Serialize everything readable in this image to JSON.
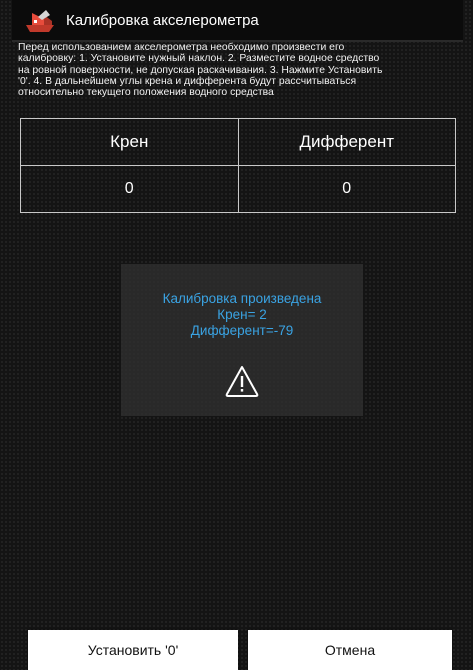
{
  "header": {
    "title": "Калибровка акселерометра",
    "icon": "boat-app-icon"
  },
  "instructions": [
    "Перед использованием акселерометра необходимо произвести его",
    "калибровку: 1. Установите нужный наклон. 2. Разместите водное средство",
    "на ровной поверхности, не допуская раскачивания. 3. Нажмите Установить",
    "'0'. 4. В дальнейшем углы крена и дифферента будут рассчитываться",
    "относительно текущего положения водного средства"
  ],
  "table": {
    "headers": [
      "Крен",
      "Дифферент"
    ],
    "values": [
      "0",
      "0"
    ]
  },
  "toast": {
    "lines": [
      "Калибровка произведена",
      "Крен= 2",
      "Дифферент=-79"
    ],
    "icon": "warning-icon",
    "text_color": "#3aa3e3"
  },
  "buttons": {
    "set_zero": "Установить '0'",
    "cancel": "Отмена"
  }
}
